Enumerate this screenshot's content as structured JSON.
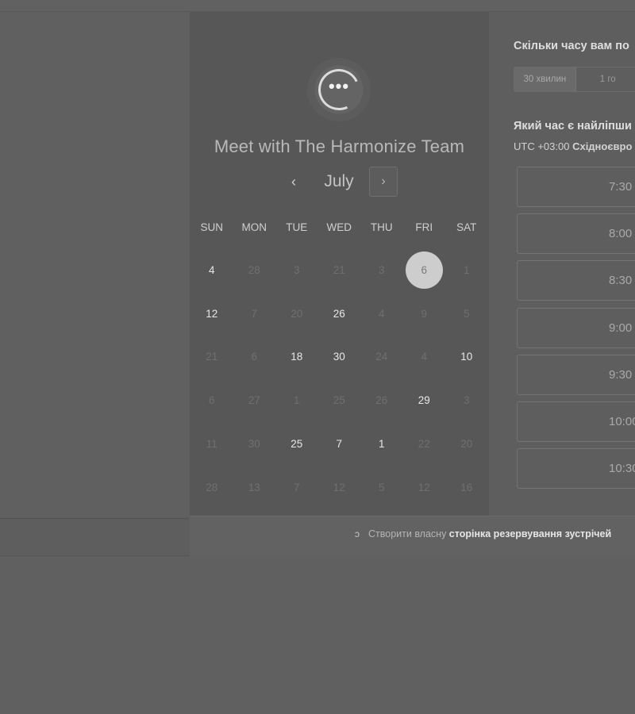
{
  "calendar": {
    "title": "Meet with The Harmonize Team",
    "month": "July",
    "prev_icon": "‹",
    "next_icon": "›",
    "weekdays": [
      "SUN",
      "MON",
      "TUE",
      "WED",
      "THU",
      "FRI",
      "SAT"
    ],
    "selected_day": "6",
    "weeks": [
      [
        "4",
        "28",
        "3",
        "21",
        "3",
        "6",
        "1"
      ],
      [
        "12",
        "7",
        "20",
        "26",
        "4",
        "9",
        "5"
      ],
      [
        "21",
        "6",
        "18",
        "30",
        "24",
        "4",
        "10"
      ],
      [
        "6",
        "27",
        "1",
        "25",
        "26",
        "29",
        "3"
      ],
      [
        "11",
        "30",
        "25",
        "7",
        "1",
        "22",
        "20"
      ],
      [
        "28",
        "13",
        "7",
        "12",
        "5",
        "12",
        "16"
      ]
    ],
    "active_days": [
      [
        true,
        false,
        false,
        false,
        false,
        true,
        false
      ],
      [
        true,
        false,
        false,
        true,
        false,
        false,
        false
      ],
      [
        false,
        false,
        true,
        true,
        false,
        false,
        true
      ],
      [
        false,
        false,
        false,
        false,
        false,
        true,
        false
      ],
      [
        false,
        false,
        true,
        true,
        true,
        false,
        false
      ],
      [
        false,
        false,
        false,
        false,
        false,
        false,
        false
      ]
    ]
  },
  "booking": {
    "duration_question": "Скільки часу вам по",
    "duration_options": [
      "30 хвилин",
      "1 го"
    ],
    "time_question": "Який час є найліпши",
    "timezone_prefix": "UTC +03:00 ",
    "timezone_name": "Східноєвро",
    "time_slots": [
      "7:30",
      "8:00",
      "8:30",
      "9:00",
      "9:30",
      "10:00",
      "10:30"
    ]
  },
  "footer": {
    "prefix": "Створити власну ",
    "link": "сторінка резервування зустрічей",
    "icon": "ↄ"
  },
  "colors": {
    "selected_day_bg": "#cdcdcd",
    "panel_bg": "#575757"
  }
}
